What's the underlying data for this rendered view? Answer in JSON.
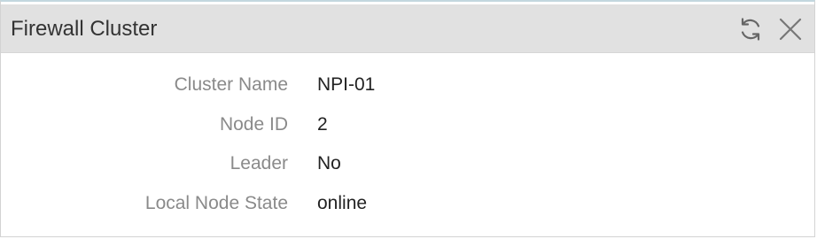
{
  "panel": {
    "title": "Firewall Cluster",
    "refresh_icon": "refresh-icon",
    "close_icon": "close-icon"
  },
  "fields": [
    {
      "label": "Cluster Name",
      "value": "NPI-01"
    },
    {
      "label": "Node ID",
      "value": "2"
    },
    {
      "label": "Leader",
      "value": "No"
    },
    {
      "label": "Local Node State",
      "value": "online"
    }
  ],
  "colors": {
    "header_bg": "#e1e1e1",
    "label_text": "#8a8a8a",
    "value_text": "#222222",
    "icon": "#666666"
  }
}
